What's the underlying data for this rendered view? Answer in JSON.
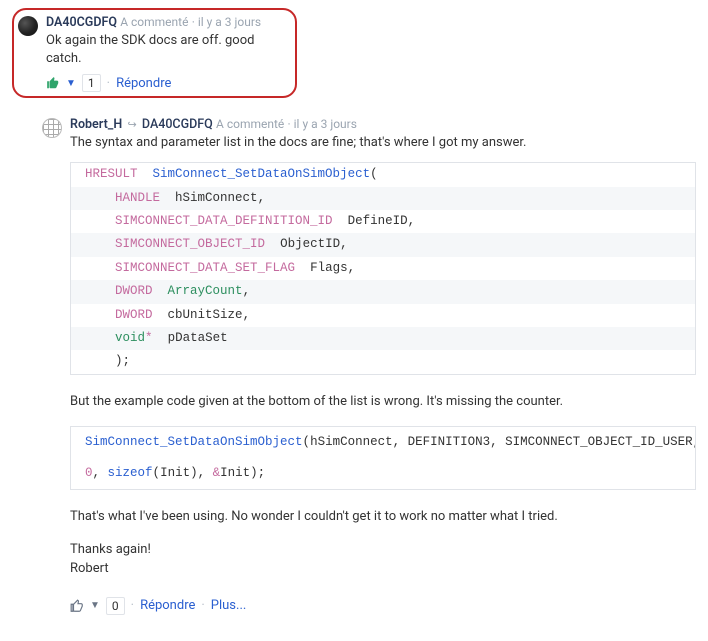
{
  "comment1": {
    "author": "DA40CGDFQ",
    "meta_action": "A commenté",
    "sep": " · ",
    "meta_time": "il y a 3 jours",
    "text": "Ok again the SDK docs are off. good catch.",
    "vote_count": "1",
    "action_reply": "Répondre"
  },
  "comment2": {
    "author": "Robert_H",
    "reply_to": "DA40CGDFQ",
    "meta_action": "A commenté",
    "sep": " · ",
    "meta_time": "il y a 3 jours",
    "intro": "The syntax and parameter list in the docs are fine; that's where I got my answer.",
    "para2": "But the example code given at the bottom of the list is wrong. It's missing the counter.",
    "para3": "That's what I've been using. No wonder I couldn't get it to work no matter what I tried.",
    "thanks": "Thanks again!",
    "sign": "Robert",
    "vote_count": "0",
    "action_reply": "Répondre",
    "action_more": "Plus..."
  },
  "code1": {
    "l1_kw": "HRESULT",
    "l1_fn": "SimConnect_SetDataOnSimObject",
    "l1_paren": "(",
    "l2_kw": "HANDLE",
    "l2_id": "hSimConnect",
    "l3_kw": "SIMCONNECT_DATA_DEFINITION_ID",
    "l3_id": "DefineID",
    "l4_kw": "SIMCONNECT_OBJECT_ID",
    "l4_id": "ObjectID",
    "l5_kw": "SIMCONNECT_DATA_SET_FLAG",
    "l5_id": "Flags",
    "l6_kw": "DWORD",
    "l6_id": "ArrayCount",
    "l7_kw": "DWORD",
    "l7_id": "cbUnitSize",
    "l8_kw": "void",
    "l8_star": "*",
    "l8_id": "pDataSet",
    "l9": ");"
  },
  "code2": {
    "fn": "SimConnect_SetDataOnSimObject",
    "open": "(",
    "a1": "hSimConnect",
    "a2": "DEFINITION3",
    "a3": "SIMCONNECT_OBJECT_ID_USER",
    "a4": "0",
    "szof": "sizeof",
    "sz_open": "(",
    "a5": "Init",
    "sz_close": ")",
    "amp": "&",
    "a6": "Init",
    "close": ");",
    "comma": ", "
  }
}
